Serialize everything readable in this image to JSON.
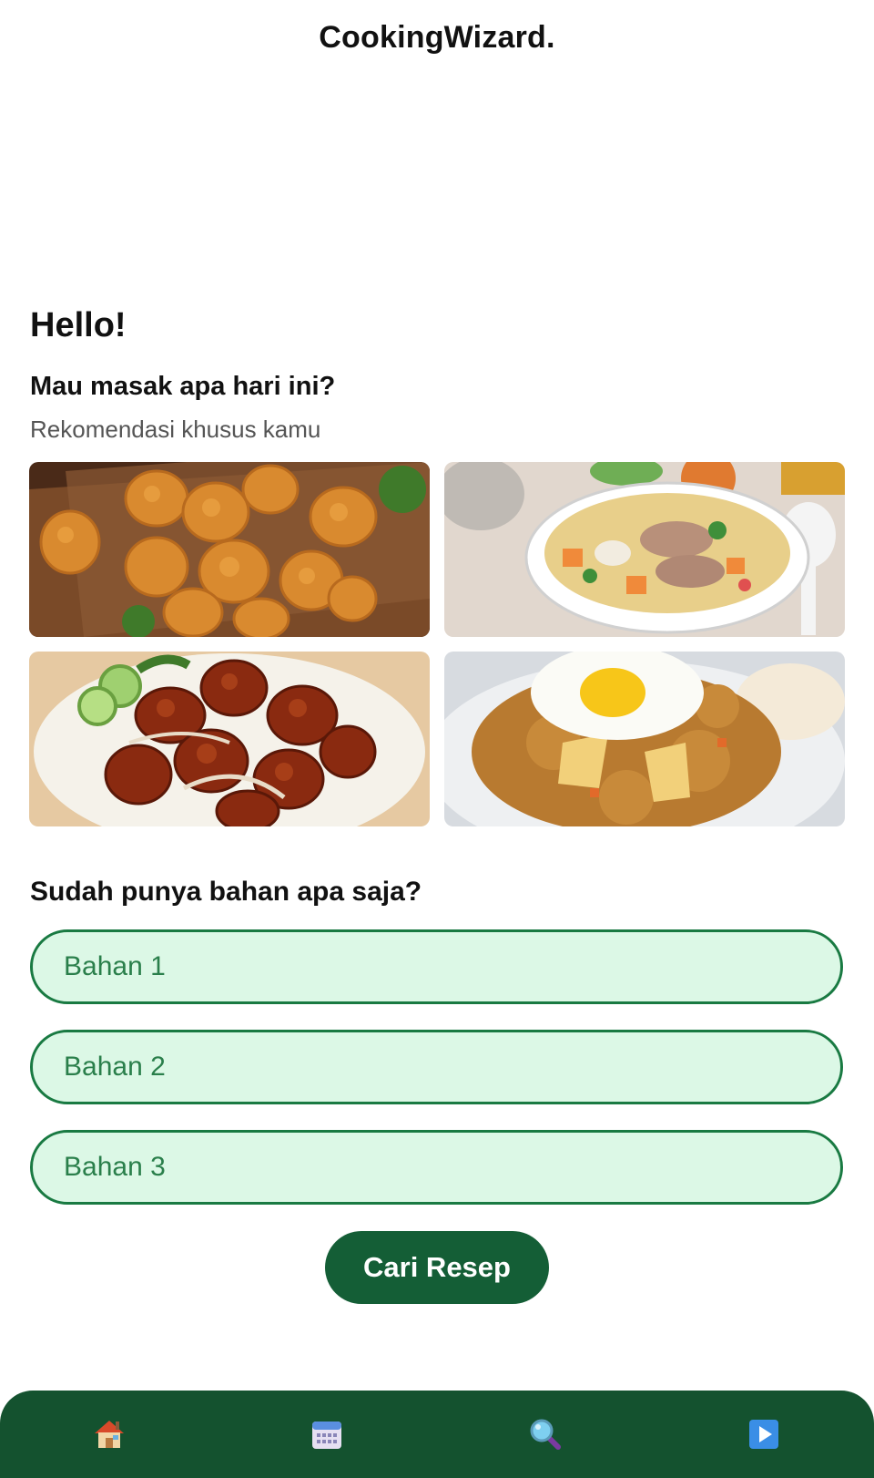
{
  "header": {
    "app_title": "CookingWizard."
  },
  "main": {
    "greeting": "Hello!",
    "question": "Mau masak apa hari ini?",
    "recommendation_subtitle": "Rekomendasi khusus kamu",
    "recommendations": [
      {
        "name": "fried-chicken-image"
      },
      {
        "name": "chicken-soup-image"
      },
      {
        "name": "sweet-soy-chicken-image"
      },
      {
        "name": "fried-rice-image"
      }
    ]
  },
  "ingredients": {
    "heading": "Sudah punya bahan apa saja?",
    "fields": [
      {
        "placeholder": "Bahan 1",
        "value": ""
      },
      {
        "placeholder": "Bahan 2",
        "value": ""
      },
      {
        "placeholder": "Bahan 3",
        "value": ""
      }
    ],
    "button_label": "Cari Resep",
    "accent_color": "#145e36",
    "field_bg": "#dcf8e6"
  },
  "bottom_nav": {
    "background": "#14522f",
    "items": [
      {
        "icon": "home-icon"
      },
      {
        "icon": "calendar-icon"
      },
      {
        "icon": "search-icon"
      },
      {
        "icon": "play-icon"
      }
    ]
  }
}
